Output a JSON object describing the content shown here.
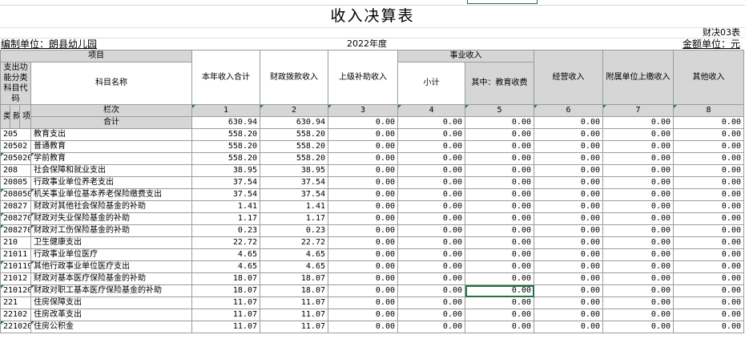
{
  "title": "收入决算表",
  "form_code": "财决03表",
  "org_label": "编制单位：朗县幼儿园",
  "year": "2022年度",
  "unit_label": "金额单位：元",
  "headers": {
    "item": "项目",
    "func_code": "支出功能分类科目代码",
    "subject_name": "科目名称",
    "col_total": "本年收入合计",
    "col_fiscal": "财政拨款收入",
    "col_superior": "上级补助收入",
    "col_business": "事业收入",
    "col_subtotal": "小计",
    "col_edu": "其中：教育收费",
    "col_operating": "经营收入",
    "col_affiliated": "附属单位上缴收入",
    "col_other": "其他收入",
    "lei": "类",
    "kuan": "款",
    "xiang": "项",
    "col_index_label": "栏次",
    "heji": "合计",
    "index": [
      "1",
      "2",
      "3",
      "4",
      "5",
      "6",
      "7",
      "8"
    ]
  },
  "totals": [
    "630.94",
    "630.94",
    "0.00",
    "0.00",
    "0.00",
    "0.00",
    "0.00",
    "0.00"
  ],
  "rows": [
    {
      "code": "205",
      "name": "教育支出",
      "indent": false,
      "v": [
        "558.20",
        "558.20",
        "0.00",
        "0.00",
        "0.00",
        "0.00",
        "0.00",
        "0.00"
      ]
    },
    {
      "code": "20502",
      "name": "普通教育",
      "indent": false,
      "v": [
        "558.20",
        "558.20",
        "0.00",
        "0.00",
        "0.00",
        "0.00",
        "0.00",
        "0.00"
      ]
    },
    {
      "code": "2050201",
      "name": "学前教育",
      "indent": true,
      "v": [
        "558.20",
        "558.20",
        "0.00",
        "0.00",
        "0.00",
        "0.00",
        "0.00",
        "0.00"
      ]
    },
    {
      "code": "208",
      "name": "社会保障和就业支出",
      "indent": false,
      "v": [
        "38.95",
        "38.95",
        "0.00",
        "0.00",
        "0.00",
        "0.00",
        "0.00",
        "0.00"
      ]
    },
    {
      "code": "20805",
      "name": "行政事业单位养老支出",
      "indent": false,
      "v": [
        "37.54",
        "37.54",
        "0.00",
        "0.00",
        "0.00",
        "0.00",
        "0.00",
        "0.00"
      ]
    },
    {
      "code": "2080505",
      "name": "机关事业单位基本养老保险缴费支出",
      "indent": true,
      "v": [
        "37.54",
        "37.54",
        "0.00",
        "0.00",
        "0.00",
        "0.00",
        "0.00",
        "0.00"
      ]
    },
    {
      "code": "20827",
      "name": "财政对其他社会保险基金的补助",
      "indent": false,
      "v": [
        "1.41",
        "1.41",
        "0.00",
        "0.00",
        "0.00",
        "0.00",
        "0.00",
        "0.00"
      ]
    },
    {
      "code": "2082701",
      "name": "财政对失业保险基金的补助",
      "indent": true,
      "v": [
        "1.17",
        "1.17",
        "0.00",
        "0.00",
        "0.00",
        "0.00",
        "0.00",
        "0.00"
      ]
    },
    {
      "code": "2082702",
      "name": "财政对工伤保险基金的补助",
      "indent": true,
      "v": [
        "0.23",
        "0.23",
        "0.00",
        "0.00",
        "0.00",
        "0.00",
        "0.00",
        "0.00"
      ]
    },
    {
      "code": "210",
      "name": "卫生健康支出",
      "indent": false,
      "v": [
        "22.72",
        "22.72",
        "0.00",
        "0.00",
        "0.00",
        "0.00",
        "0.00",
        "0.00"
      ]
    },
    {
      "code": "21011",
      "name": "行政事业单位医疗",
      "indent": false,
      "v": [
        "4.65",
        "4.65",
        "0.00",
        "0.00",
        "0.00",
        "0.00",
        "0.00",
        "0.00"
      ]
    },
    {
      "code": "2101199",
      "name": "其他行政事业单位医疗支出",
      "indent": true,
      "v": [
        "4.65",
        "4.65",
        "0.00",
        "0.00",
        "0.00",
        "0.00",
        "0.00",
        "0.00"
      ]
    },
    {
      "code": "21012",
      "name": "财政对基本医疗保险基金的补助",
      "indent": false,
      "v": [
        "18.07",
        "18.07",
        "0.00",
        "0.00",
        "0.00",
        "0.00",
        "0.00",
        "0.00"
      ]
    },
    {
      "code": "2101201",
      "name": "财政对职工基本医疗保险基金的补助",
      "indent": true,
      "v": [
        "18.07",
        "18.07",
        "0.00",
        "0.00",
        "0.00",
        "0.00",
        "0.00",
        "0.00"
      ]
    },
    {
      "code": "221",
      "name": "住房保障支出",
      "indent": false,
      "v": [
        "11.07",
        "11.07",
        "0.00",
        "0.00",
        "0.00",
        "0.00",
        "0.00",
        "0.00"
      ]
    },
    {
      "code": "22102",
      "name": "住房改革支出",
      "indent": false,
      "v": [
        "11.07",
        "11.07",
        "0.00",
        "0.00",
        "0.00",
        "0.00",
        "0.00",
        "0.00"
      ]
    },
    {
      "code": "2210201",
      "name": "住房公积金",
      "indent": true,
      "v": [
        "11.07",
        "11.07",
        "0.00",
        "0.00",
        "0.00",
        "0.00",
        "0.00",
        "0.00"
      ]
    }
  ]
}
